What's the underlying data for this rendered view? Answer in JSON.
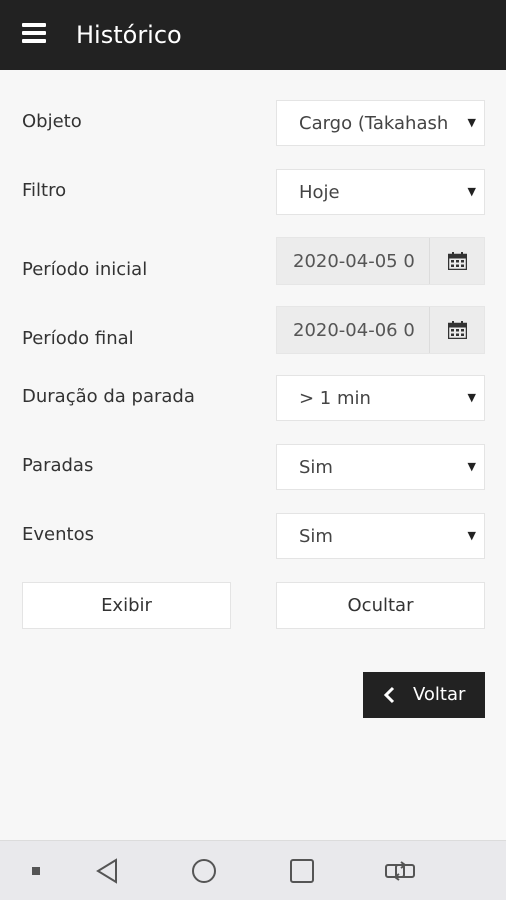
{
  "header": {
    "title": "Histórico"
  },
  "form": {
    "objeto": {
      "label": "Objeto",
      "value": "Cargo (Takahashi)"
    },
    "filtro": {
      "label": "Filtro",
      "value": "Hoje"
    },
    "periodo_inicial": {
      "label": "Período inicial",
      "value": "2020-04-05 0"
    },
    "periodo_final": {
      "label": "Período final",
      "value": "2020-04-06 0"
    },
    "duracao_parada": {
      "label": "Duração da parada",
      "value": "> 1 min"
    },
    "paradas": {
      "label": "Paradas",
      "value": "Sim"
    },
    "eventos": {
      "label": "Eventos",
      "value": "Sim"
    }
  },
  "buttons": {
    "exibir": "Exibir",
    "ocultar": "Ocultar",
    "voltar": "Voltar"
  },
  "icons": {
    "menu": "menu-icon",
    "calendar": "calendar-icon",
    "back": "chevron-left-icon",
    "nav": [
      "dot-icon",
      "back-triangle-icon",
      "home-circle-icon",
      "recents-square-icon",
      "switch-apps-icon"
    ]
  },
  "colors": {
    "appbar": "#222222",
    "background": "#f7f7f7",
    "navbar": "#e9e9ec"
  }
}
